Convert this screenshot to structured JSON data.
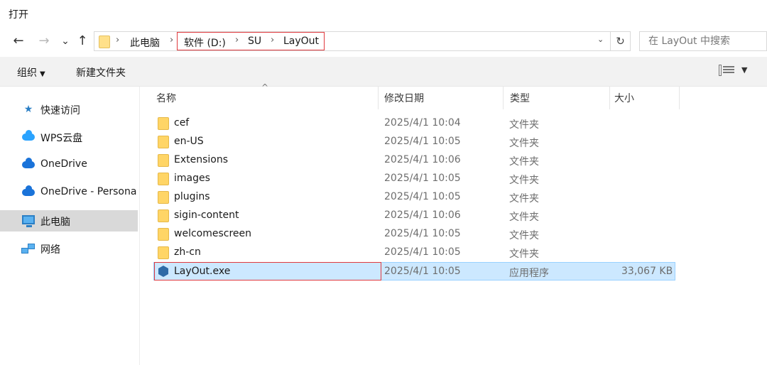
{
  "window": {
    "title": "打开"
  },
  "nav": {
    "back": "←",
    "forward": "→",
    "recent": "⌄",
    "up": "↑"
  },
  "address": {
    "crumbs": [
      "此电脑",
      "软件 (D:)",
      "SU",
      "LayOut"
    ],
    "separator": "›",
    "dropdown": "⌄",
    "refresh": "↻"
  },
  "search": {
    "placeholder": "在 LayOut 中搜索"
  },
  "toolbar": {
    "organize": "组织",
    "organize_caret": "▼",
    "new_folder": "新建文件夹",
    "view_caret": "▼"
  },
  "sidebar": {
    "items": [
      {
        "label": "快速访问",
        "icon": "star-icon"
      },
      {
        "label": "WPS云盘",
        "icon": "wps-cloud-icon"
      },
      {
        "label": "OneDrive",
        "icon": "onedrive-icon"
      },
      {
        "label": "OneDrive - Persona",
        "icon": "onedrive-icon"
      },
      {
        "label": "此电脑",
        "icon": "computer-icon"
      },
      {
        "label": "网络",
        "icon": "network-icon"
      }
    ],
    "selected_index": 4
  },
  "columns": {
    "name": "名称",
    "modified": "修改日期",
    "type": "类型",
    "size": "大小",
    "sort_indicator": "^"
  },
  "files": [
    {
      "name": "cef",
      "modified": "2025/4/1 10:04",
      "type": "文件夹",
      "size": "",
      "icon": "folder-icon"
    },
    {
      "name": "en-US",
      "modified": "2025/4/1 10:05",
      "type": "文件夹",
      "size": "",
      "icon": "folder-icon"
    },
    {
      "name": "Extensions",
      "modified": "2025/4/1 10:06",
      "type": "文件夹",
      "size": "",
      "icon": "folder-icon"
    },
    {
      "name": "images",
      "modified": "2025/4/1 10:05",
      "type": "文件夹",
      "size": "",
      "icon": "folder-icon"
    },
    {
      "name": "plugins",
      "modified": "2025/4/1 10:05",
      "type": "文件夹",
      "size": "",
      "icon": "folder-icon"
    },
    {
      "name": "sigin-content",
      "modified": "2025/4/1 10:06",
      "type": "文件夹",
      "size": "",
      "icon": "folder-icon"
    },
    {
      "name": "welcomescreen",
      "modified": "2025/4/1 10:05",
      "type": "文件夹",
      "size": "",
      "icon": "folder-icon"
    },
    {
      "name": "zh-cn",
      "modified": "2025/4/1 10:05",
      "type": "文件夹",
      "size": "",
      "icon": "folder-icon"
    },
    {
      "name": "LayOut.exe",
      "modified": "2025/4/1 10:05",
      "type": "应用程序",
      "size": "33,067 KB",
      "icon": "exe-icon"
    }
  ],
  "selected_file_index": 8,
  "colors": {
    "highlight": "#e0393e",
    "selection": "#cce8ff",
    "folder": "#ffd566"
  }
}
